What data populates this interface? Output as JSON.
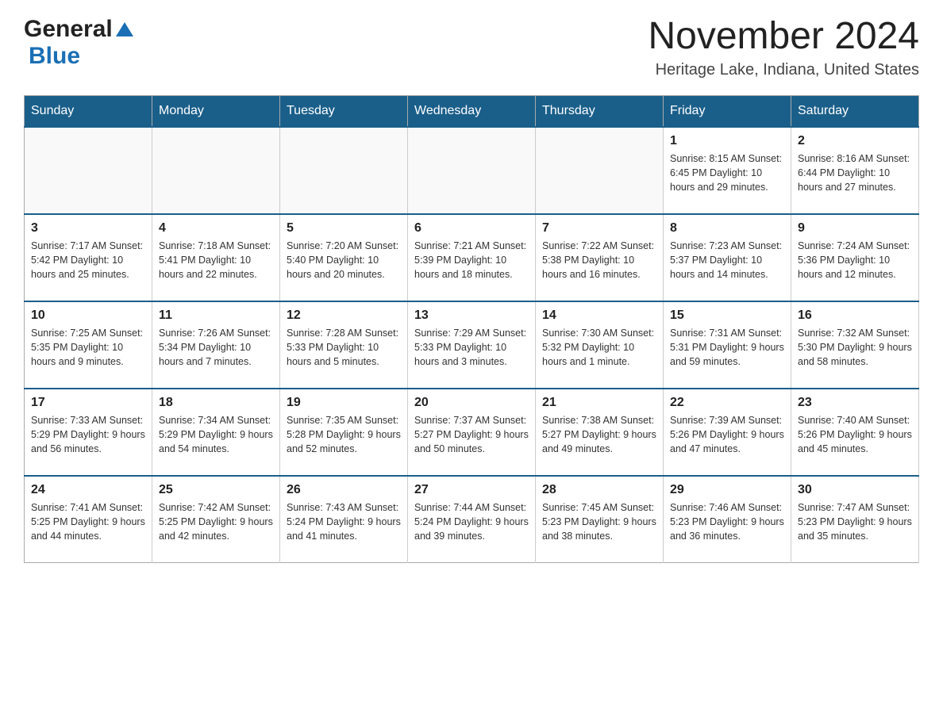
{
  "header": {
    "logo_general": "General",
    "logo_blue": "Blue",
    "title": "November 2024",
    "subtitle": "Heritage Lake, Indiana, United States"
  },
  "weekdays": [
    "Sunday",
    "Monday",
    "Tuesday",
    "Wednesday",
    "Thursday",
    "Friday",
    "Saturday"
  ],
  "weeks": [
    [
      {
        "day": "",
        "info": ""
      },
      {
        "day": "",
        "info": ""
      },
      {
        "day": "",
        "info": ""
      },
      {
        "day": "",
        "info": ""
      },
      {
        "day": "",
        "info": ""
      },
      {
        "day": "1",
        "info": "Sunrise: 8:15 AM\nSunset: 6:45 PM\nDaylight: 10 hours and 29 minutes."
      },
      {
        "day": "2",
        "info": "Sunrise: 8:16 AM\nSunset: 6:44 PM\nDaylight: 10 hours and 27 minutes."
      }
    ],
    [
      {
        "day": "3",
        "info": "Sunrise: 7:17 AM\nSunset: 5:42 PM\nDaylight: 10 hours and 25 minutes."
      },
      {
        "day": "4",
        "info": "Sunrise: 7:18 AM\nSunset: 5:41 PM\nDaylight: 10 hours and 22 minutes."
      },
      {
        "day": "5",
        "info": "Sunrise: 7:20 AM\nSunset: 5:40 PM\nDaylight: 10 hours and 20 minutes."
      },
      {
        "day": "6",
        "info": "Sunrise: 7:21 AM\nSunset: 5:39 PM\nDaylight: 10 hours and 18 minutes."
      },
      {
        "day": "7",
        "info": "Sunrise: 7:22 AM\nSunset: 5:38 PM\nDaylight: 10 hours and 16 minutes."
      },
      {
        "day": "8",
        "info": "Sunrise: 7:23 AM\nSunset: 5:37 PM\nDaylight: 10 hours and 14 minutes."
      },
      {
        "day": "9",
        "info": "Sunrise: 7:24 AM\nSunset: 5:36 PM\nDaylight: 10 hours and 12 minutes."
      }
    ],
    [
      {
        "day": "10",
        "info": "Sunrise: 7:25 AM\nSunset: 5:35 PM\nDaylight: 10 hours and 9 minutes."
      },
      {
        "day": "11",
        "info": "Sunrise: 7:26 AM\nSunset: 5:34 PM\nDaylight: 10 hours and 7 minutes."
      },
      {
        "day": "12",
        "info": "Sunrise: 7:28 AM\nSunset: 5:33 PM\nDaylight: 10 hours and 5 minutes."
      },
      {
        "day": "13",
        "info": "Sunrise: 7:29 AM\nSunset: 5:33 PM\nDaylight: 10 hours and 3 minutes."
      },
      {
        "day": "14",
        "info": "Sunrise: 7:30 AM\nSunset: 5:32 PM\nDaylight: 10 hours and 1 minute."
      },
      {
        "day": "15",
        "info": "Sunrise: 7:31 AM\nSunset: 5:31 PM\nDaylight: 9 hours and 59 minutes."
      },
      {
        "day": "16",
        "info": "Sunrise: 7:32 AM\nSunset: 5:30 PM\nDaylight: 9 hours and 58 minutes."
      }
    ],
    [
      {
        "day": "17",
        "info": "Sunrise: 7:33 AM\nSunset: 5:29 PM\nDaylight: 9 hours and 56 minutes."
      },
      {
        "day": "18",
        "info": "Sunrise: 7:34 AM\nSunset: 5:29 PM\nDaylight: 9 hours and 54 minutes."
      },
      {
        "day": "19",
        "info": "Sunrise: 7:35 AM\nSunset: 5:28 PM\nDaylight: 9 hours and 52 minutes."
      },
      {
        "day": "20",
        "info": "Sunrise: 7:37 AM\nSunset: 5:27 PM\nDaylight: 9 hours and 50 minutes."
      },
      {
        "day": "21",
        "info": "Sunrise: 7:38 AM\nSunset: 5:27 PM\nDaylight: 9 hours and 49 minutes."
      },
      {
        "day": "22",
        "info": "Sunrise: 7:39 AM\nSunset: 5:26 PM\nDaylight: 9 hours and 47 minutes."
      },
      {
        "day": "23",
        "info": "Sunrise: 7:40 AM\nSunset: 5:26 PM\nDaylight: 9 hours and 45 minutes."
      }
    ],
    [
      {
        "day": "24",
        "info": "Sunrise: 7:41 AM\nSunset: 5:25 PM\nDaylight: 9 hours and 44 minutes."
      },
      {
        "day": "25",
        "info": "Sunrise: 7:42 AM\nSunset: 5:25 PM\nDaylight: 9 hours and 42 minutes."
      },
      {
        "day": "26",
        "info": "Sunrise: 7:43 AM\nSunset: 5:24 PM\nDaylight: 9 hours and 41 minutes."
      },
      {
        "day": "27",
        "info": "Sunrise: 7:44 AM\nSunset: 5:24 PM\nDaylight: 9 hours and 39 minutes."
      },
      {
        "day": "28",
        "info": "Sunrise: 7:45 AM\nSunset: 5:23 PM\nDaylight: 9 hours and 38 minutes."
      },
      {
        "day": "29",
        "info": "Sunrise: 7:46 AM\nSunset: 5:23 PM\nDaylight: 9 hours and 36 minutes."
      },
      {
        "day": "30",
        "info": "Sunrise: 7:47 AM\nSunset: 5:23 PM\nDaylight: 9 hours and 35 minutes."
      }
    ]
  ]
}
